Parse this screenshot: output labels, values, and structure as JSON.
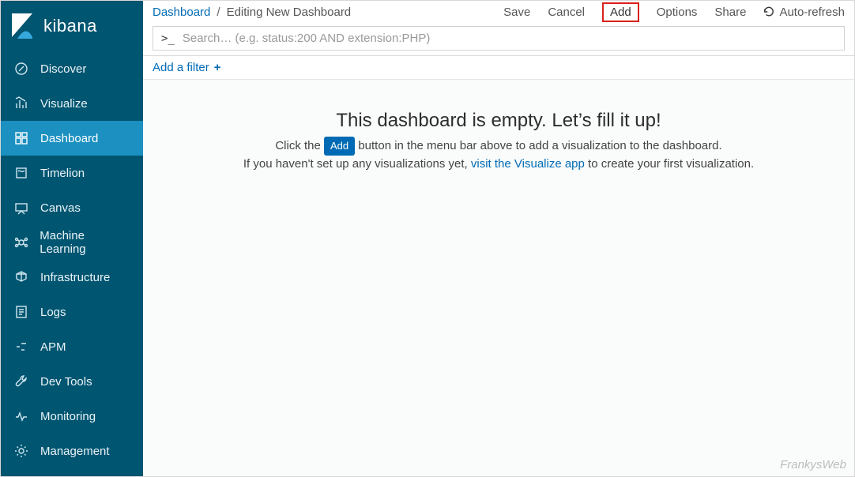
{
  "brand": "kibana",
  "sidebar": {
    "items": [
      {
        "label": "Discover"
      },
      {
        "label": "Visualize"
      },
      {
        "label": "Dashboard"
      },
      {
        "label": "Timelion"
      },
      {
        "label": "Canvas"
      },
      {
        "label": "Machine Learning"
      },
      {
        "label": "Infrastructure"
      },
      {
        "label": "Logs"
      },
      {
        "label": "APM"
      },
      {
        "label": "Dev Tools"
      },
      {
        "label": "Monitoring"
      },
      {
        "label": "Management"
      }
    ],
    "active_index": 2
  },
  "breadcrumb": {
    "root": "Dashboard",
    "sep": "/",
    "current": "Editing New Dashboard"
  },
  "actions": {
    "save": "Save",
    "cancel": "Cancel",
    "add": "Add",
    "options": "Options",
    "share": "Share",
    "auto_refresh": "Auto-refresh"
  },
  "search": {
    "placeholder": "Search… (e.g. status:200 AND extension:PHP)"
  },
  "filter": {
    "add_label": "Add a filter"
  },
  "empty": {
    "heading": "This dashboard is empty. Let’s fill it up!",
    "line1_pre": "Click the ",
    "line1_token": "Add",
    "line1_post": " button in the menu bar above to add a visualization to the dashboard.",
    "line2_pre": "If you haven't set up any visualizations yet, ",
    "line2_link": "visit the Visualize app",
    "line2_post": " to create your first visualization."
  },
  "watermark": "FrankysWeb"
}
